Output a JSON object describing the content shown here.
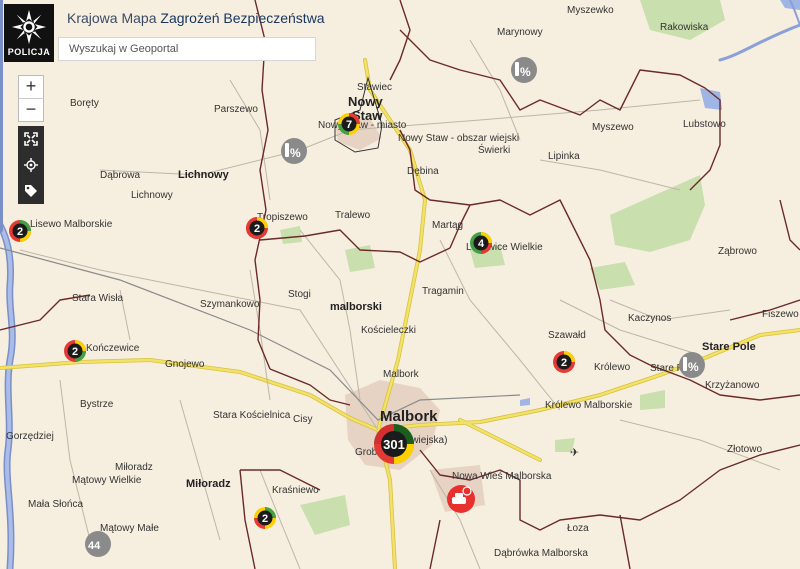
{
  "app": {
    "logo_text": "POLICJA",
    "title_part1": "Krajowa Mapa",
    "title_part2": "Zagrożeń Bezpieczeństwa",
    "search_placeholder": "Wyszukaj w Geoportal"
  },
  "controls": {
    "zoom_in": "+",
    "zoom_out": "−",
    "tools": [
      "fullscreen-icon",
      "locate-icon",
      "tag-icon"
    ]
  },
  "places": {
    "myszewko": "Myszewko",
    "rakowiska": "Rakowiska",
    "marynowy": "Marynowy",
    "stawiec": "Stawiec",
    "nowy": "Nowy",
    "staw": "Staw",
    "nowy_staw_miasto": "Nowy Staw - miasto",
    "nowy_staw_wiejski": "Nowy Staw - obszar wiejski",
    "boręty": "Boręty",
    "parszewo": "Parszewo",
    "myszewo": "Myszewo",
    "lubstowo": "Lubstowo",
    "lichnowy": "Lichnowy",
    "lichnowy_small": "Lichnowy",
    "swierki": "Świerki",
    "lipinka": "Lipinka",
    "debina": "Dębina",
    "dabrowa": "Dąbrowa",
    "lisewo_malborskie": "Lisewo Malborskie",
    "tropiszewo": "Tropiszewo",
    "tralewo": "Tralewo",
    "martag": "Martąg",
    "lasowice_wielkie": "Lasowice Wielkie",
    "zabrowo": "Ząbrowo",
    "stogi": "Stogi",
    "malborski": "malborski",
    "tragamin": "Tragamin",
    "szymankowo": "Szymankowo",
    "stara_wisla": "Stara Wisła",
    "koscieleczki": "Kościeleczki",
    "kaczynos": "Kaczynos",
    "fiszewo": "Fiszewo",
    "szawald": "Szawałd",
    "stare_pole": "Stare Pole",
    "konczewice": "Kończewice",
    "gnojewo": "Gnojewo",
    "malbork_small": "Malbork",
    "krolewo": "Królewo",
    "krzyzanowo": "Krzyżanowo",
    "bystrze": "Bystrze",
    "malbork": "Malbork",
    "krolewo_malborskie": "Królewo Malborskie",
    "stara_koscielnica": "Stara Kościelnica",
    "cisy": "Cisy",
    "gorzedziej": "Gorzędziej",
    "zlotowo": "Złotowo",
    "milorady_small": "Miłoradz",
    "nowa_wies_malborska": "Nowa Wieś Malborska",
    "matowy_wielkie": "Mątowy Wielkie",
    "miloradz": "Miłoradz",
    "krasniewo": "Kraśniewo",
    "mala_slonca": "Mała Słońca",
    "matowy_male": "Mątowy Małe",
    "loza": "Łoza",
    "dabrowka_malborska": "Dąbrówka Malborska",
    "stare_pole_small": "Stare Pole",
    "grobelno": "Grobel",
    "rs_wiejska": "(wiejska)"
  },
  "clusters": [
    {
      "id": "nowy-staw",
      "count": "7"
    },
    {
      "id": "lisewo",
      "count": "2"
    },
    {
      "id": "tropiszewo",
      "count": "2"
    },
    {
      "id": "lasowice",
      "count": "4"
    },
    {
      "id": "konczewice",
      "count": "2"
    },
    {
      "id": "szawald",
      "count": "2"
    },
    {
      "id": "malbork",
      "count": "301"
    },
    {
      "id": "krasniewo",
      "count": "2"
    }
  ],
  "markers": {
    "marynowy_pct": "%",
    "nowy_staw_pct": "%",
    "stare_pole_pct": "%",
    "matowy_speed": "44"
  },
  "colors": {
    "river": "#7a8fc8",
    "main_road": "#e9d84a",
    "border": "#6b2a2a",
    "green_area": "#c9dfae",
    "urban": "#e6d3c3"
  }
}
